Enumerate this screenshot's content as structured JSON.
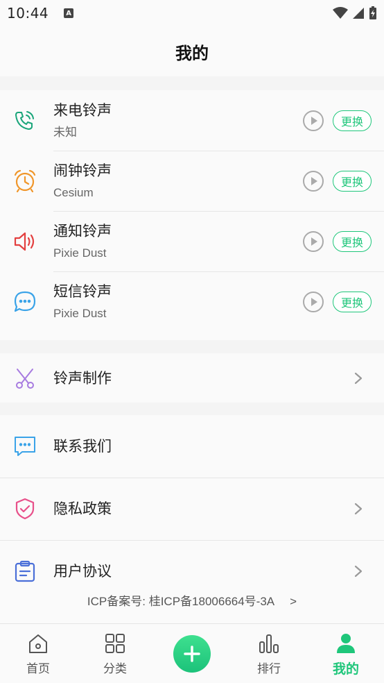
{
  "status_bar": {
    "time": "10:44",
    "notification_badge": "A"
  },
  "header": {
    "title": "我的"
  },
  "ringtones": [
    {
      "label": "来电铃声",
      "value": "未知",
      "icon": "phone-ringing-icon",
      "color": "#1aa57a"
    },
    {
      "label": "闹钟铃声",
      "value": "Cesium",
      "icon": "alarm-clock-icon",
      "color": "#f0962a"
    },
    {
      "label": "通知铃声",
      "value": "Pixie Dust",
      "icon": "speaker-icon",
      "color": "#e34040"
    },
    {
      "label": "短信铃声",
      "value": "Pixie Dust",
      "icon": "chat-bubble-icon",
      "color": "#3aa3e8"
    }
  ],
  "change_label": "更换",
  "tools": {
    "ringtone_maker": "铃声制作"
  },
  "menu": {
    "contact": "联系我们",
    "privacy": "隐私政策",
    "agreement": "用户协议"
  },
  "footer": {
    "icp": "ICP备案号: 桂ICP备18006664号-3A",
    "arrow": ">"
  },
  "nav": {
    "home": "首页",
    "category": "分类",
    "rank": "排行",
    "mine": "我的"
  },
  "colors": {
    "accent": "#1ec67a"
  }
}
